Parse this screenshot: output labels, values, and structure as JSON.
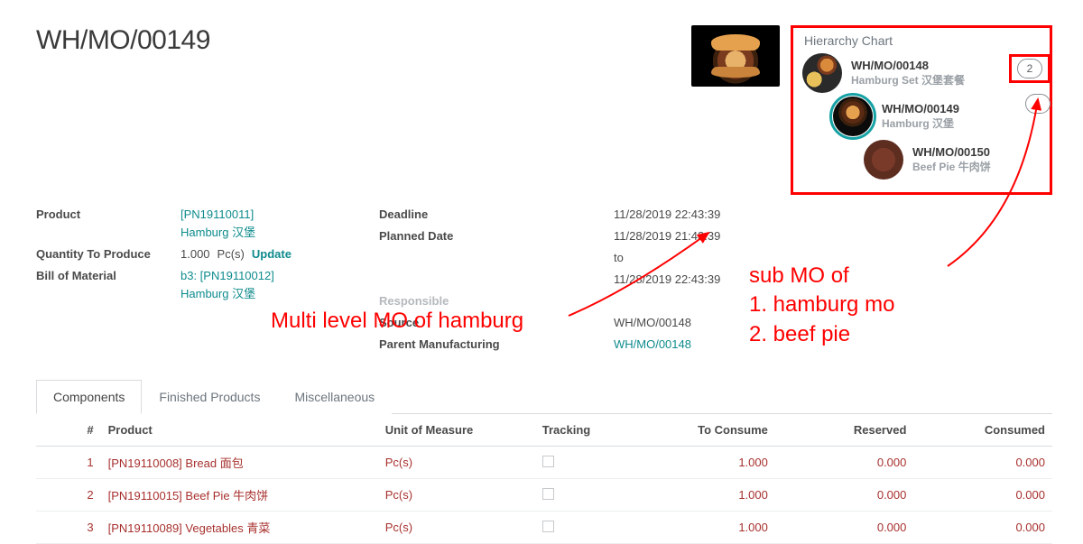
{
  "title": "WH/MO/00149",
  "stat_badges": {
    "top": "2",
    "bottom": "1"
  },
  "hierarchy": {
    "heading": "Hierarchy Chart",
    "items": [
      {
        "order": "WH/MO/00148",
        "product": "Hamburg Set 汉堡套餐",
        "level": 1,
        "selected": false
      },
      {
        "order": "WH/MO/00149",
        "product": "Hamburg 汉堡",
        "level": 2,
        "selected": true
      },
      {
        "order": "WH/MO/00150",
        "product": "Beef Pie 牛肉饼",
        "level": 3,
        "selected": false
      }
    ]
  },
  "fields": {
    "product_label": "Product",
    "product_val_line1": "[PN19110011]",
    "product_val_line2": "Hamburg 汉堡",
    "qty_label": "Quantity To Produce",
    "qty_val": "1.000",
    "qty_uom": "Pc(s)",
    "qty_update": "Update",
    "bom_label": "Bill of Material",
    "bom_val_line1": "b3: [PN19110012]",
    "bom_val_line2": "Hamburg 汉堡",
    "deadline_label": "Deadline",
    "deadline_val": "11/28/2019 22:43:39",
    "planned_label": "Planned Date",
    "planned_from": "11/28/2019 21:43:39",
    "planned_to_word": "to",
    "planned_to": "11/28/2019 22:43:39",
    "responsible_label": "Responsible",
    "source_label": "Source",
    "source_val": "WH/MO/00148",
    "parent_label": "Parent Manufacturing",
    "parent_val": "WH/MO/00148"
  },
  "tabs": {
    "components": "Components",
    "finished": "Finished Products",
    "misc": "Miscellaneous"
  },
  "table": {
    "headers": {
      "idx": "#",
      "product": "Product",
      "uom": "Unit of Measure",
      "tracking": "Tracking",
      "to_consume": "To Consume",
      "reserved": "Reserved",
      "consumed": "Consumed"
    },
    "rows": [
      {
        "idx": "1",
        "product": "[PN19110008] Bread 面包",
        "uom": "Pc(s)",
        "to_consume": "1.000",
        "reserved": "0.000",
        "consumed": "0.000"
      },
      {
        "idx": "2",
        "product": "[PN19110015] Beef Pie 牛肉饼",
        "uom": "Pc(s)",
        "to_consume": "1.000",
        "reserved": "0.000",
        "consumed": "0.000"
      },
      {
        "idx": "3",
        "product": "[PN19110089] Vegetables 青菜",
        "uom": "Pc(s)",
        "to_consume": "1.000",
        "reserved": "0.000",
        "consumed": "0.000"
      }
    ]
  },
  "annotations": {
    "multi": "Multi level MO of  hamburg",
    "sub_title": "sub MO of",
    "sub_l1": "1. hamburg mo",
    "sub_l2": "2. beef pie"
  }
}
